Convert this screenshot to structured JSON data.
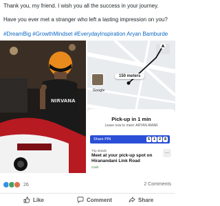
{
  "post": {
    "line1": "Thank you, my friend. I wish you all the success in your journey.",
    "line2": "Have you ever met a stranger who left a lasting impression on you?",
    "hashtags": "#DreamBig #GrowthMindset #EverydayInspiration Aryan Bamburde"
  },
  "ride_app": {
    "distance_label": "150 meters",
    "map_brand": "Google",
    "pickup_title": "Pick-up in 1 min",
    "pickup_subtitle": "Leave now to meet: ARYAN AMAR",
    "share_pin_label": "Share PIN",
    "pin_digits": [
      "5",
      "1",
      "2",
      "8"
    ],
    "trip_details_label": "Trip details",
    "trip_title": "Meet at your pick-up spot on Hiranandani Link Road",
    "payment": "Cash",
    "more_label": "...",
    "accent_color": "#2a4fd6"
  },
  "social": {
    "reactions_count": "26",
    "comments_count": "2 Comments"
  },
  "actions": {
    "like": "Like",
    "comment": "Comment",
    "share": "Share"
  },
  "icons": [
    "like-reaction-icon",
    "celebrate-reaction-icon",
    "love-reaction-icon",
    "thumbs-up-icon",
    "comment-icon",
    "share-icon",
    "navigation-arrow-icon"
  ]
}
